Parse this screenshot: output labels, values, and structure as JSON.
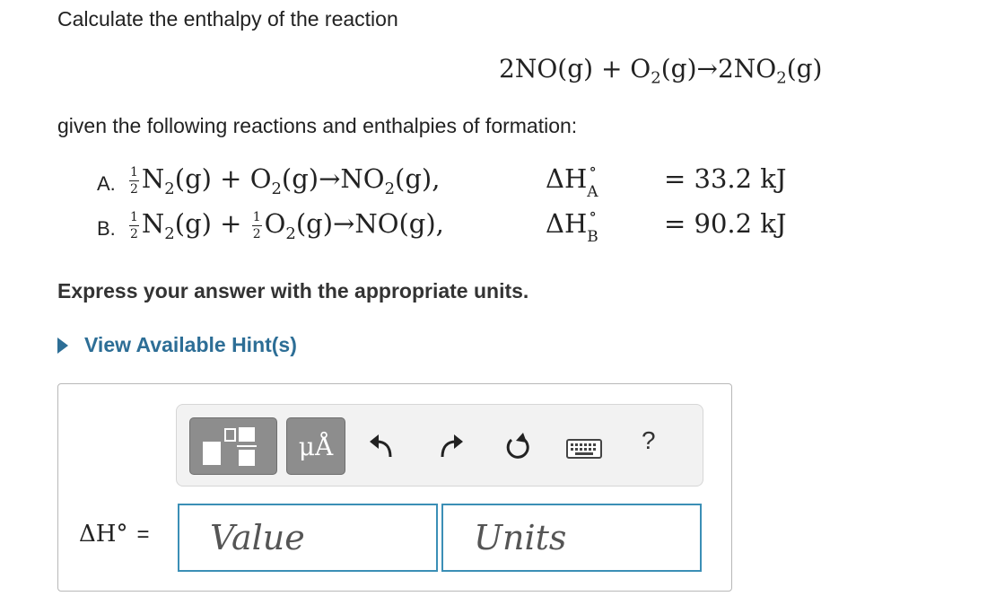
{
  "question": "Calculate the enthalpy of the reaction",
  "main_equation": {
    "left": "2NO(g) + O",
    "o2_sub": "2",
    "mid": "(g)→2NO",
    "no2_sub": "2",
    "right": "(g)"
  },
  "given_text": "given the following reactions and enthalpies of formation:",
  "reactions": [
    {
      "letter": "A.",
      "frac1_num": "1",
      "frac1_den": "2",
      "n2": "N",
      "n2_sub": "2",
      "n2_state": "(g) + ",
      "frac2_num": "",
      "frac2_den": "",
      "o2": "O",
      "o2_sub": "2",
      "o2_state": "(g)→NO",
      "prod_sub": "2",
      "prod_state": "(g),",
      "dh": "ΔH",
      "dh_sup": "∘",
      "dh_sub": "A",
      "value": "= 33.2 kJ"
    },
    {
      "letter": "B.",
      "frac1_num": "1",
      "frac1_den": "2",
      "n2": "N",
      "n2_sub": "2",
      "n2_state": "(g) + ",
      "frac2_num": "1",
      "frac2_den": "2",
      "o2": "O",
      "o2_sub": "2",
      "o2_state": "(g)→NO(g),",
      "prod_sub": "",
      "prod_state": "",
      "dh": "ΔH",
      "dh_sup": "∘",
      "dh_sub": "B",
      "value": "= 90.2 kJ"
    }
  ],
  "instruction": "Express your answer with the appropriate units.",
  "hints_link": "View Available Hint(s)",
  "toolbar": {
    "units_button": "μÅ",
    "help": "?",
    "icons": [
      "templates-icon",
      "units-icon",
      "undo-icon",
      "redo-icon",
      "reset-icon",
      "keyboard-icon",
      "help-icon"
    ]
  },
  "answer": {
    "label": "ΔH°",
    "equals": "=",
    "value_placeholder": "Value",
    "units_placeholder": "Units"
  },
  "colors": {
    "link": "#2d6e96",
    "input_border": "#3b8fb6",
    "toolbar_bg": "#f2f2f2",
    "dark_button": "#8d8d8d"
  }
}
